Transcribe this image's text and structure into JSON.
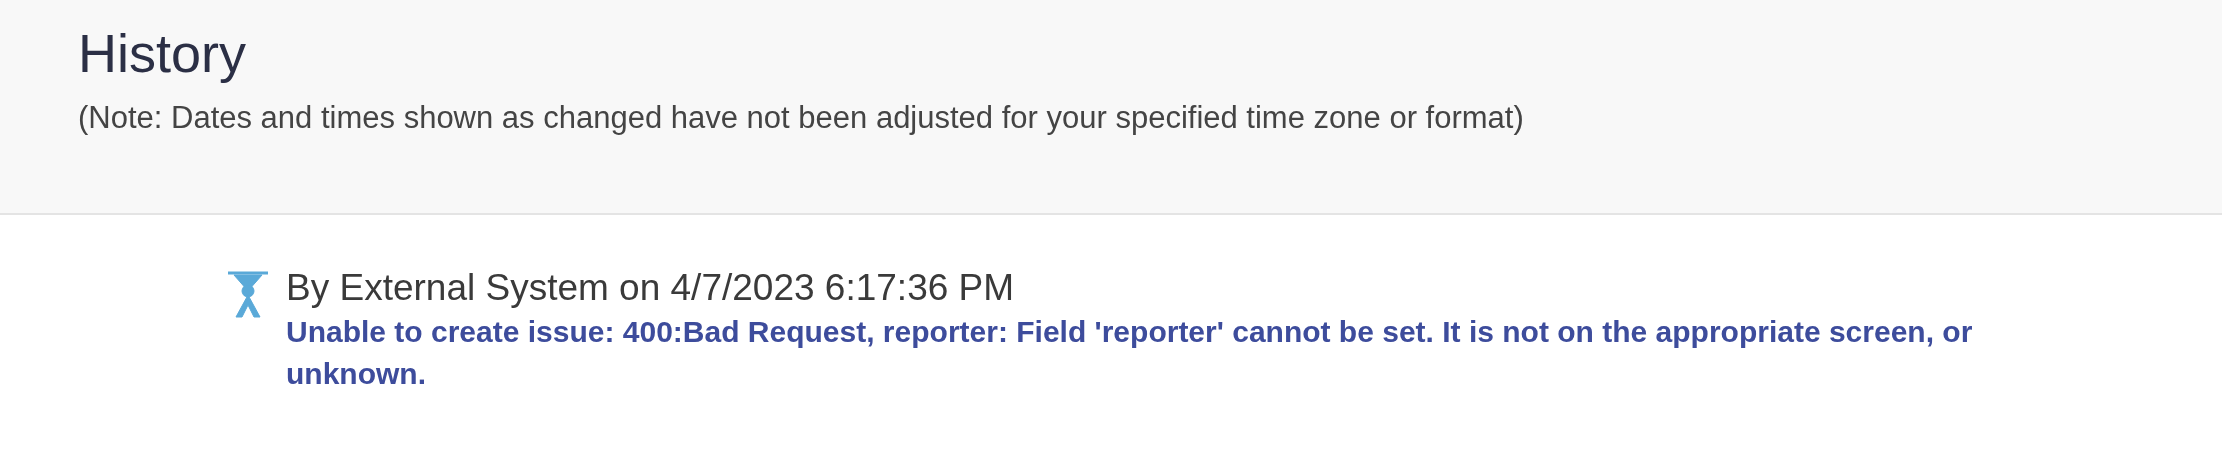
{
  "header": {
    "title": "History",
    "note": "(Note: Dates and times shown as changed have not been adjusted for your specified time zone or format)"
  },
  "entries": [
    {
      "byline": "By External System on 4/7/2023 6:17:36 PM",
      "message": "Unable to create issue: 400:Bad Request, reporter: Field 'reporter' cannot be set. It is not on the appropriate screen, or unknown."
    }
  ]
}
